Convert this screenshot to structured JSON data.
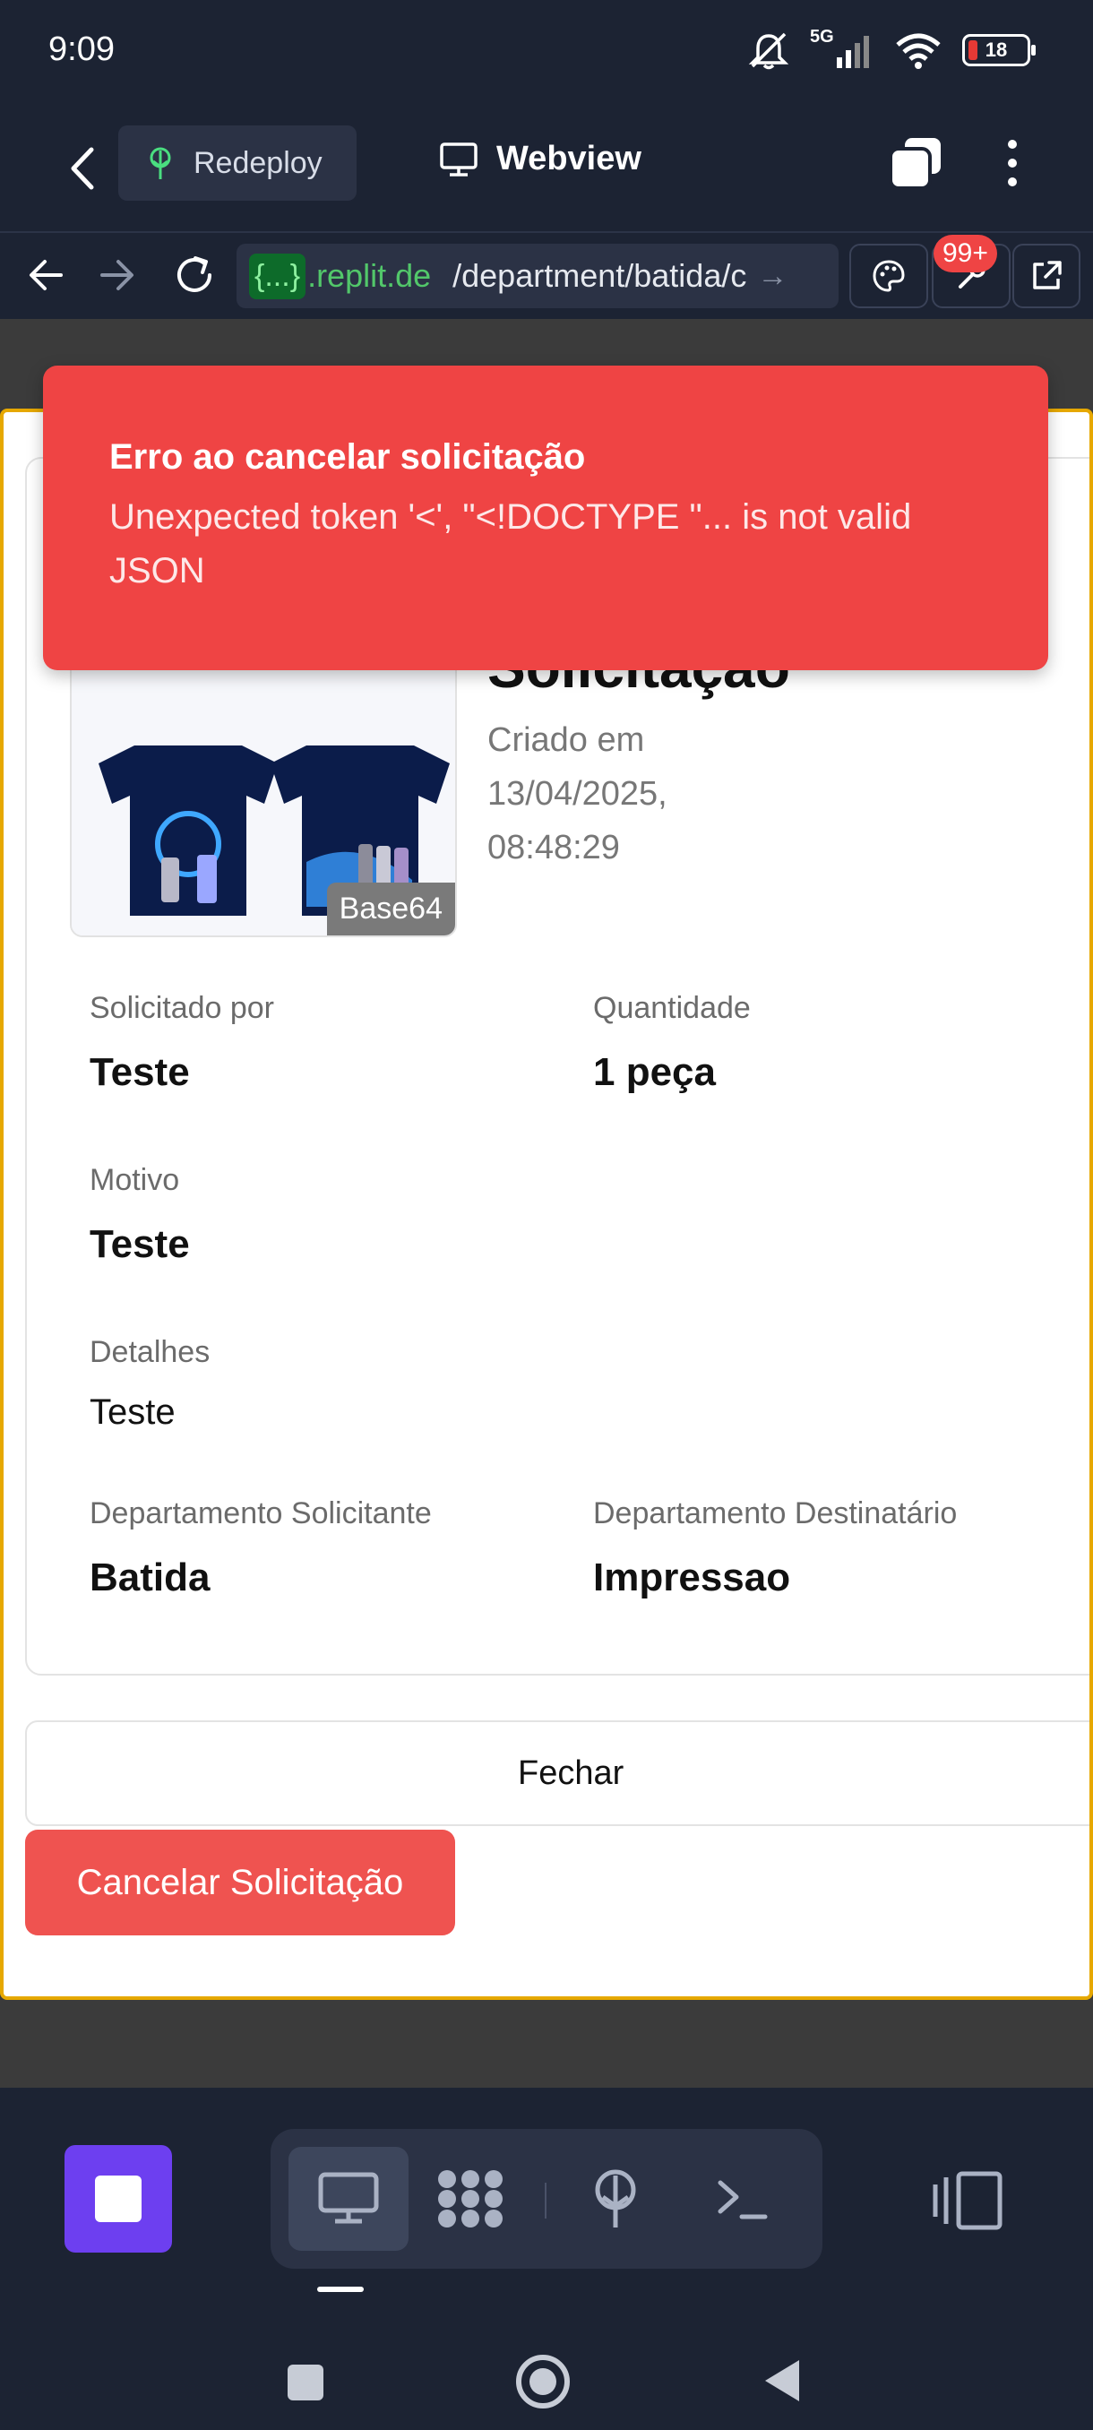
{
  "status_bar": {
    "time": "9:09",
    "network": "5G",
    "battery": "18",
    "icons": [
      "mute-icon",
      "signal-icon",
      "wifi-icon",
      "battery-icon"
    ]
  },
  "header": {
    "redeploy_label": "Redeploy",
    "webview_title": "Webview"
  },
  "url_bar": {
    "badge": "{...}",
    "host": ".replit.de",
    "path": "/department/batida/c",
    "notifications_badge": "99+"
  },
  "toast": {
    "title": "Erro ao cancelar solicitação",
    "message": "Unexpected token '<', \"<!DOCTYPE \"... is not valid JSON",
    "color": "#ef4444"
  },
  "request": {
    "title": "Solicitação",
    "created": "Criado em 13/04/2025, 08:48:29",
    "image_tag": "Base64",
    "fields": {
      "requested_by_label": "Solicitado por",
      "requested_by_value": "Teste",
      "quantity_label": "Quantidade",
      "quantity_value": "1 peça",
      "reason_label": "Motivo",
      "reason_value": "Teste",
      "details_label": "Detalhes",
      "details_value": "Teste",
      "requesting_dept_label": "Departamento Solicitante",
      "requesting_dept_value": "Batida",
      "target_dept_label": "Departamento Destinatário",
      "target_dept_value": "Impressao"
    }
  },
  "actions": {
    "close_label": "Fechar",
    "cancel_label": "Cancelar Solicitação",
    "cancel_color": "#ef5350"
  },
  "colors": {
    "replit_bg": "#1c2333",
    "dialog_border": "#e6a800",
    "stop_button": "#6d3ff0"
  }
}
